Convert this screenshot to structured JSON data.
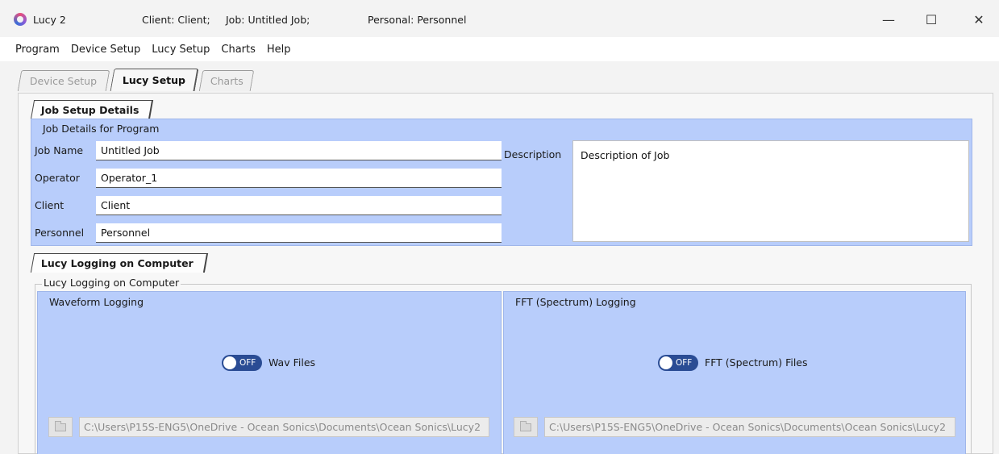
{
  "window": {
    "app_title": "Lucy 2",
    "client_status": "Client: Client;",
    "job_status": "Job: Untitled Job;",
    "personal_status": "Personal: Personnel",
    "minimize_glyph": "—",
    "maximize_glyph": "☐",
    "close_glyph": "✕"
  },
  "menu": {
    "items": [
      "Program",
      "Device Setup",
      "Lucy Setup",
      "Charts",
      "Help"
    ]
  },
  "tabs": {
    "items": [
      "Device Setup",
      "Lucy Setup",
      "Charts"
    ],
    "active": "Lucy Setup"
  },
  "job_setup": {
    "tab_label": "Job Setup Details",
    "panel_title": "Job Details for Program",
    "job_name_label": "Job Name",
    "job_name_value": "Untitled Job",
    "operator_label": "Operator",
    "operator_value": "Operator_1",
    "client_label": "Client",
    "client_value": "Client",
    "personnel_label": "Personnel",
    "personnel_value": "Personnel",
    "description_label": "Description",
    "description_value": "Description of Job"
  },
  "logging": {
    "tab_label": "Lucy Logging on Computer",
    "group_title": "Lucy Logging on Computer",
    "waveform": {
      "title": "Waveform Logging",
      "toggle_state": "OFF",
      "toggle_label": "Wav Files",
      "path": "C:\\Users\\P15S-ENG5\\OneDrive - Ocean Sonics\\Documents\\Ocean Sonics\\Lucy2"
    },
    "fft": {
      "title": "FFT (Spectrum) Logging",
      "toggle_state": "OFF",
      "toggle_label": "FFT (Spectrum) Files",
      "path": "C:\\Users\\P15S-ENG5\\OneDrive - Ocean Sonics\\Documents\\Ocean Sonics\\Lucy2"
    }
  },
  "colors": {
    "panel_blue": "#b8cdfb",
    "toggle_off": "#2a4c94"
  }
}
